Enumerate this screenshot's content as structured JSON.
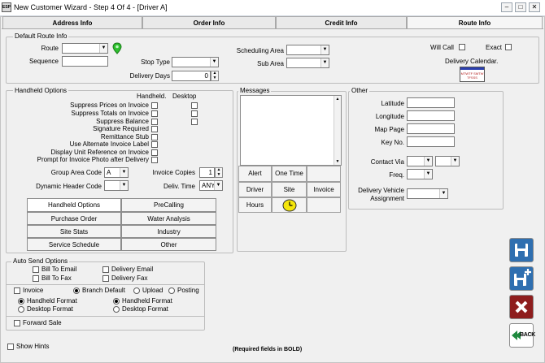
{
  "window": {
    "icon_text": "ESP",
    "title": "New Customer Wizard - Step 4 Of 4 - [Driver A]"
  },
  "tabs": [
    "Address Info",
    "Order Info",
    "Credit Info",
    "Route Info"
  ],
  "default_route": {
    "title": "Default Route Info",
    "route_label": "Route",
    "sequence_label": "Sequence",
    "stop_type_label": "Stop Type",
    "delivery_days_label": "Delivery Days",
    "delivery_days_value": "0",
    "scheduling_area_label": "Scheduling Area",
    "sub_area_label": "Sub Area",
    "will_call_label": "Will Call",
    "exact_label": "Exact",
    "delivery_calendar_label": "Delivery Calendar.",
    "calendar_icon_text": "MTWTF SMTWTFSSS"
  },
  "handheld": {
    "title": "Handheld Options",
    "col_handheld": "Handheld.",
    "col_desktop": "Desktop",
    "options": [
      "Suppress Prices on Invoice",
      "Suppress Totals on Invoice",
      "Suppress Balance",
      "Signature Required",
      "Remittance Stub",
      "Use Alternate Invoice Label",
      "Display Unit Reference on Invoice",
      "Prompt for Invoice Photo after Delivery"
    ],
    "group_area_code_label": "Group Area Code",
    "group_area_code_value": "A",
    "invoice_copies_label": "Invoice Copies",
    "invoice_copies_value": "1",
    "dynamic_header_label": "Dynamic Header Code",
    "deliv_time_label": "Deliv. Time",
    "deliv_time_value": "ANY",
    "buttons": [
      "Handheld Options",
      "PreCalling",
      "Purchase Order",
      "Water Analysis",
      "Site Stats",
      "Industry",
      "Service Schedule",
      "Other"
    ]
  },
  "messages": {
    "title": "Messages",
    "grid": [
      "Alert",
      "One Time",
      "",
      "Driver",
      "Site",
      "Invoice",
      "Hours",
      "",
      ""
    ]
  },
  "other": {
    "title": "Other",
    "latitude_label": "Latitude",
    "longitude_label": "Longitude",
    "map_page_label": "Map Page",
    "key_no_label": "Key No.",
    "contact_via_label": "Contact Via",
    "freq_label": "Freq.",
    "vehicle_label_1": "Delivery Vehicle",
    "vehicle_label_2": "Assignment"
  },
  "auto_send": {
    "title": "Auto Send Options",
    "bill_email": "Bill To Email",
    "delivery_email": "Delivery Email",
    "bill_fax": "Bill To Fax",
    "delivery_fax": "Delivery Fax",
    "invoice": "Invoice",
    "branch_default": "Branch Default",
    "upload": "Upload",
    "posting": "Posting",
    "handheld_format": "Handheld Format",
    "desktop_format": "Desktop Format",
    "forward_sale": "Forward Sale"
  },
  "footer": {
    "show_hints": "Show Hints",
    "required_note": "(Required fields in BOLD)"
  },
  "side_buttons": {
    "back_label": "BACK"
  },
  "colors": {
    "save_blue": "#2f6fb0",
    "cancel_red": "#8e1d1d",
    "back_green": "#1e8a3e",
    "pin_green": "#2ec02e",
    "clock_yellow": "#f5e60a"
  }
}
